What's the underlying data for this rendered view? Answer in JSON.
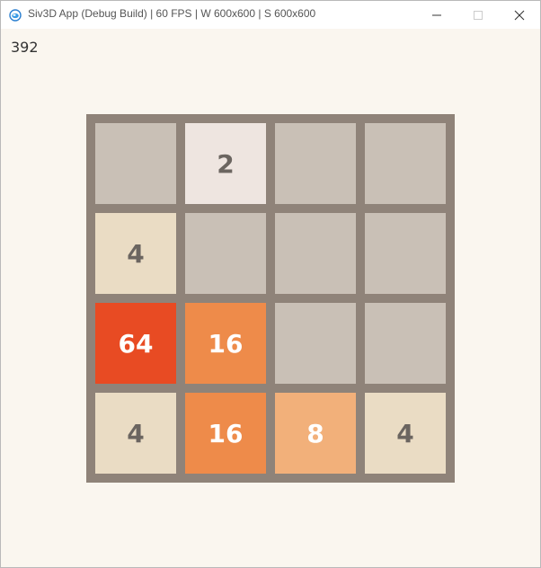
{
  "window": {
    "title": "Siv3D App (Debug Build) | 60 FPS | W 600x600 | S 600x600",
    "icon": "siv3d-app-icon",
    "controls": {
      "minimize": "minimize-icon",
      "maximize": "maximize-icon",
      "close": "close-icon"
    }
  },
  "game": {
    "score": "392",
    "board_color": "#8f8379",
    "background_color": "#faf6ef",
    "tiles": [
      {
        "value": "",
        "bg": "#c9c0b6",
        "fg": "#6b6560"
      },
      {
        "value": "2",
        "bg": "#eee5e0",
        "fg": "#6b6560"
      },
      {
        "value": "",
        "bg": "#c9c0b6",
        "fg": "#6b6560"
      },
      {
        "value": "",
        "bg": "#c9c0b6",
        "fg": "#6b6560"
      },
      {
        "value": "4",
        "bg": "#eadcc4",
        "fg": "#6b6560"
      },
      {
        "value": "",
        "bg": "#c9c0b6",
        "fg": "#6b6560"
      },
      {
        "value": "",
        "bg": "#c9c0b6",
        "fg": "#6b6560"
      },
      {
        "value": "",
        "bg": "#c9c0b6",
        "fg": "#6b6560"
      },
      {
        "value": "64",
        "bg": "#e84b23",
        "fg": "#ffffff"
      },
      {
        "value": "16",
        "bg": "#ee8b4a",
        "fg": "#ffffff"
      },
      {
        "value": "",
        "bg": "#c9c0b6",
        "fg": "#6b6560"
      },
      {
        "value": "",
        "bg": "#c9c0b6",
        "fg": "#6b6560"
      },
      {
        "value": "4",
        "bg": "#eadcc4",
        "fg": "#6b6560"
      },
      {
        "value": "16",
        "bg": "#ee8b4a",
        "fg": "#ffffff"
      },
      {
        "value": "8",
        "bg": "#f2b07a",
        "fg": "#ffffff"
      },
      {
        "value": "4",
        "bg": "#eadcc4",
        "fg": "#6b6560"
      }
    ]
  }
}
